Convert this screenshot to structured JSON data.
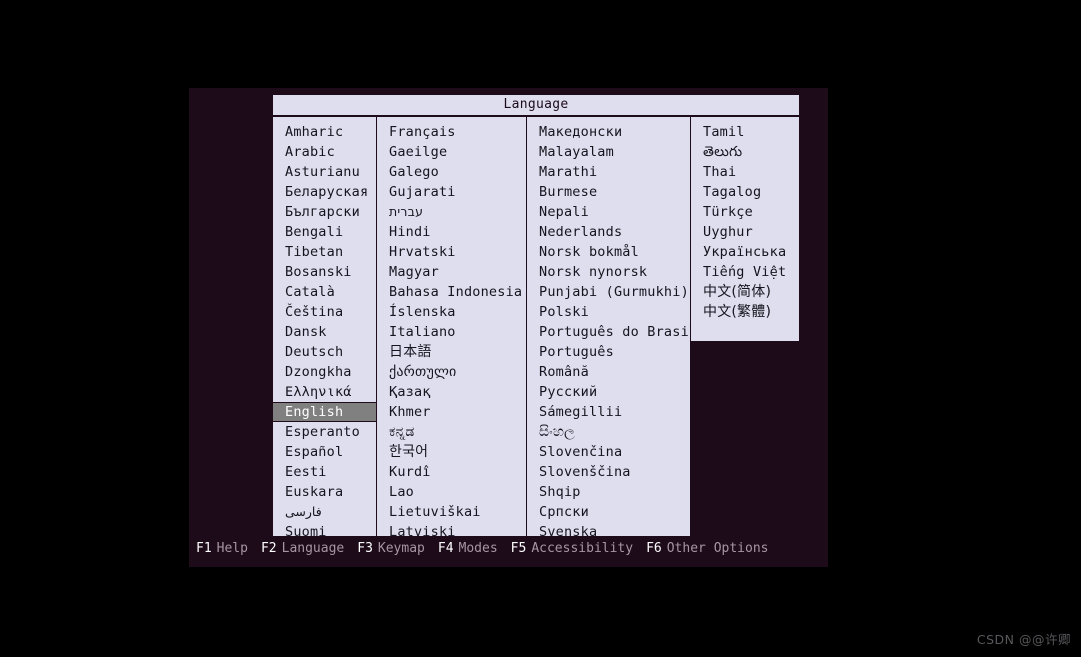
{
  "screen": {
    "background_color": "#000000",
    "console_background_color": "#1d0b19"
  },
  "dialog": {
    "title": "Language",
    "panel_color": "#dedeee",
    "border_color": "#1d0b19",
    "selection_color": "#808080",
    "selected_language": "English",
    "columns": [
      {
        "id": "column-1",
        "items": [
          {
            "label": "Amharic",
            "script": "latin"
          },
          {
            "label": "Arabic",
            "script": "latin"
          },
          {
            "label": "Asturianu",
            "script": "latin"
          },
          {
            "label": "Беларуская",
            "script": "latin"
          },
          {
            "label": "Български",
            "script": "latin"
          },
          {
            "label": "Bengali",
            "script": "latin"
          },
          {
            "label": "Tibetan",
            "script": "latin"
          },
          {
            "label": "Bosanski",
            "script": "latin"
          },
          {
            "label": "Català",
            "script": "latin"
          },
          {
            "label": "Čeština",
            "script": "latin"
          },
          {
            "label": "Dansk",
            "script": "latin"
          },
          {
            "label": "Deutsch",
            "script": "latin"
          },
          {
            "label": "Dzongkha",
            "script": "latin"
          },
          {
            "label": "Ελληνικά",
            "script": "latin"
          },
          {
            "label": "English",
            "script": "latin",
            "selected": true
          },
          {
            "label": "Esperanto",
            "script": "latin"
          },
          {
            "label": "Español",
            "script": "latin"
          },
          {
            "label": "Eesti",
            "script": "latin"
          },
          {
            "label": "Euskara",
            "script": "latin"
          },
          {
            "label": "فارسی",
            "script": "rtl"
          },
          {
            "label": "Suomi",
            "script": "latin"
          }
        ]
      },
      {
        "id": "column-2",
        "items": [
          {
            "label": "Français",
            "script": "latin"
          },
          {
            "label": "Gaeilge",
            "script": "latin"
          },
          {
            "label": "Galego",
            "script": "latin"
          },
          {
            "label": "Gujarati",
            "script": "latin"
          },
          {
            "label": "עברית",
            "script": "rtl"
          },
          {
            "label": "Hindi",
            "script": "latin"
          },
          {
            "label": "Hrvatski",
            "script": "latin"
          },
          {
            "label": "Magyar",
            "script": "latin"
          },
          {
            "label": "Bahasa Indonesia",
            "script": "latin"
          },
          {
            "label": "Íslenska",
            "script": "latin"
          },
          {
            "label": "Italiano",
            "script": "latin"
          },
          {
            "label": "日本語",
            "script": "cjk"
          },
          {
            "label": "ქართული",
            "script": "indic"
          },
          {
            "label": "Қазақ",
            "script": "latin"
          },
          {
            "label": "Khmer",
            "script": "latin"
          },
          {
            "label": "ಕನ್ನಡ",
            "script": "indic"
          },
          {
            "label": "한국어",
            "script": "cjk"
          },
          {
            "label": "Kurdî",
            "script": "latin"
          },
          {
            "label": "Lao",
            "script": "latin"
          },
          {
            "label": "Lietuviškai",
            "script": "latin"
          },
          {
            "label": "Latviski",
            "script": "latin"
          }
        ]
      },
      {
        "id": "column-3",
        "items": [
          {
            "label": "Македонски",
            "script": "latin"
          },
          {
            "label": "Malayalam",
            "script": "latin"
          },
          {
            "label": "Marathi",
            "script": "latin"
          },
          {
            "label": "Burmese",
            "script": "latin"
          },
          {
            "label": "Nepali",
            "script": "latin"
          },
          {
            "label": "Nederlands",
            "script": "latin"
          },
          {
            "label": "Norsk bokmål",
            "script": "latin"
          },
          {
            "label": "Norsk nynorsk",
            "script": "latin"
          },
          {
            "label": "Punjabi (Gurmukhi)",
            "script": "latin"
          },
          {
            "label": "Polski",
            "script": "latin"
          },
          {
            "label": "Português do Brasil",
            "script": "latin"
          },
          {
            "label": "Português",
            "script": "latin"
          },
          {
            "label": "Română",
            "script": "latin"
          },
          {
            "label": "Русский",
            "script": "latin"
          },
          {
            "label": "Sámegillii",
            "script": "latin"
          },
          {
            "label": "සිංහල",
            "script": "indic"
          },
          {
            "label": "Slovenčina",
            "script": "latin"
          },
          {
            "label": "Slovenščina",
            "script": "latin"
          },
          {
            "label": "Shqip",
            "script": "latin"
          },
          {
            "label": "Српски",
            "script": "latin"
          },
          {
            "label": "Svenska",
            "script": "latin"
          }
        ]
      },
      {
        "id": "column-4",
        "items": [
          {
            "label": "Tamil",
            "script": "latin"
          },
          {
            "label": "తెలుగు",
            "script": "indic"
          },
          {
            "label": "Thai",
            "script": "latin"
          },
          {
            "label": "Tagalog",
            "script": "latin"
          },
          {
            "label": "Türkçe",
            "script": "latin"
          },
          {
            "label": "Uyghur",
            "script": "latin"
          },
          {
            "label": "Українська",
            "script": "latin"
          },
          {
            "label": "Tiếng Việt",
            "script": "latin"
          },
          {
            "label": "中文(简体)",
            "script": "cjk"
          },
          {
            "label": "中文(繁體)",
            "script": "cjk"
          }
        ]
      }
    ]
  },
  "function_bar": {
    "keys": [
      {
        "key": "F1",
        "label": "Help"
      },
      {
        "key": "F2",
        "label": "Language"
      },
      {
        "key": "F3",
        "label": "Keymap"
      },
      {
        "key": "F4",
        "label": "Modes"
      },
      {
        "key": "F5",
        "label": "Accessibility"
      },
      {
        "key": "F6",
        "label": "Other Options"
      }
    ],
    "key_color": "#ffffff",
    "label_color": "#a795a2"
  },
  "watermark": {
    "text": "CSDN @@许卿"
  }
}
